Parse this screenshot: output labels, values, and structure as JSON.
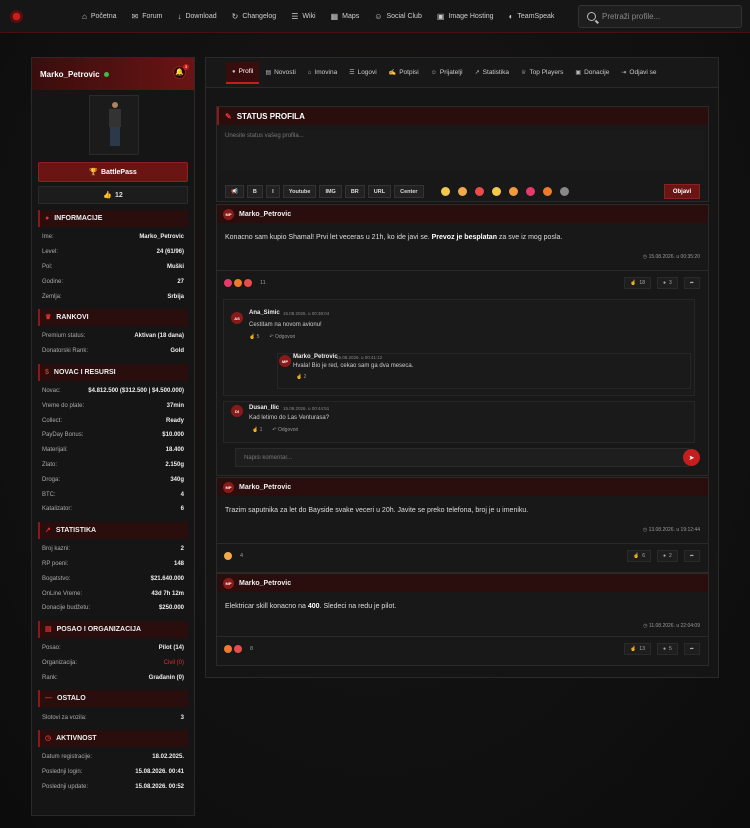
{
  "nav": {
    "items": [
      {
        "label": "Početna",
        "icon": "home-icon"
      },
      {
        "label": "Forum",
        "icon": "comments-icon"
      },
      {
        "label": "Download",
        "icon": "download-icon"
      },
      {
        "label": "Changelog",
        "icon": "changelog-icon"
      },
      {
        "label": "Wiki",
        "icon": "book-icon"
      },
      {
        "label": "Maps",
        "icon": "map-icon"
      },
      {
        "label": "Social Club",
        "icon": "users-icon"
      },
      {
        "label": "Image Hosting",
        "icon": "image-icon"
      },
      {
        "label": "TeamSpeak",
        "icon": "headset-icon"
      }
    ],
    "search_placeholder": "Pretraži profile..."
  },
  "profile": {
    "name": "Marko_Petrovic",
    "notifications": "3",
    "battlepass_label": "BattlePass",
    "likes": "12"
  },
  "sections": [
    {
      "title": "INFORMACIJE",
      "icon": "user-icon",
      "rows": [
        {
          "k": "Ime:",
          "v": "Marko_Petrovic"
        },
        {
          "k": "Level:",
          "v": "24 (61/96)"
        },
        {
          "k": "Pol:",
          "v": "Muški"
        },
        {
          "k": "Godine:",
          "v": "27"
        },
        {
          "k": "Zemlja:",
          "v": "Srbija"
        }
      ]
    },
    {
      "title": "RANKOVI",
      "icon": "crown-icon",
      "rows": [
        {
          "k": "Premium status:",
          "v": "Aktivan (18 dana)"
        },
        {
          "k": "Donatorski Rank:",
          "v": "Gold"
        }
      ]
    },
    {
      "title": "NOVAC I RESURSI",
      "icon": "dollar-icon",
      "rows": [
        {
          "k": "Novac:",
          "v": "$4.812.500 ($312.500 | $4.500.000)"
        },
        {
          "k": "Vreme do plate:",
          "v": "37min"
        },
        {
          "k": "Collect:",
          "v": "Ready"
        },
        {
          "k": "PayDay Bonus:",
          "v": "$10.000"
        },
        {
          "k": "Materijali:",
          "v": "18.400"
        },
        {
          "k": "Zlato:",
          "v": "2.150g"
        },
        {
          "k": "Droga:",
          "v": "340g"
        },
        {
          "k": "BTC:",
          "v": "4"
        },
        {
          "k": "Katalizator:",
          "v": "6"
        }
      ]
    },
    {
      "title": "STATISTIKA",
      "icon": "chart-icon",
      "rows": [
        {
          "k": "Broj kazni:",
          "v": "2"
        },
        {
          "k": "RP poeni:",
          "v": "148"
        },
        {
          "k": "Bogatstvo:",
          "v": "$21.640.000"
        },
        {
          "k": "OnLine Vreme:",
          "v": "43d 7h 12m"
        },
        {
          "k": "Donacije budžetu:",
          "v": "$250.000"
        }
      ]
    },
    {
      "title": "POSAO I ORGANIZACIJA",
      "icon": "briefcase-icon",
      "rows": [
        {
          "k": "Posao:",
          "v": "Pilot (14)"
        },
        {
          "k": "Organizacija:",
          "v": "Civil (0)",
          "red": true
        },
        {
          "k": "Rank:",
          "v": "Građanin (0)"
        }
      ]
    },
    {
      "title": "OSTALO",
      "icon": "dash-icon",
      "rows": [
        {
          "k": "Slotovi za vozila:",
          "v": "3"
        }
      ]
    },
    {
      "title": "AKTIVNOST",
      "icon": "clock-icon",
      "rows": [
        {
          "k": "Datum registracije:",
          "v": "18.02.2025."
        },
        {
          "k": "Poslednji login:",
          "v": "15.08.2026. 00:41"
        },
        {
          "k": "Poslednji update:",
          "v": "15.08.2026. 00:52"
        }
      ]
    }
  ],
  "tabs": [
    {
      "label": "Profil",
      "icon": "user-icon",
      "active": true
    },
    {
      "label": "Novosti",
      "icon": "news-icon"
    },
    {
      "label": "Imovina",
      "icon": "home-icon"
    },
    {
      "label": "Logovi",
      "icon": "list-icon"
    },
    {
      "label": "Potpisi",
      "icon": "signature-icon"
    },
    {
      "label": "Prijatelji",
      "icon": "friends-icon"
    },
    {
      "label": "Statistika",
      "icon": "chart-icon"
    },
    {
      "label": "Top Players",
      "icon": "trophy-icon"
    },
    {
      "label": "Donacije",
      "icon": "donate-icon"
    },
    {
      "label": "Odjavi se",
      "icon": "logout-icon"
    }
  ],
  "status": {
    "title": "STATUS PROFILA",
    "placeholder": "Unesite status vašeg profila...",
    "toolbar": [
      "B",
      "I",
      "Youtube",
      "IMG",
      "BR",
      "URL",
      "Center"
    ],
    "submit": "Objavi"
  },
  "posts": [
    {
      "avatar": "MP",
      "author": "Marko_Petrovic",
      "text_before": "Konacno sam kupio Shamal! Prvi let veceras u 21h, ko ide javi se. ",
      "text_bold": "Prevoz je besplatan",
      "text_after": " za sve iz mog posla.",
      "date": "15.08.2026. u 00:35:20",
      "reaction_count": "11",
      "likes": "18",
      "comments": "3"
    },
    {
      "avatar": "MP",
      "author": "Marko_Petrovic",
      "text_before": "Trazim saputnika za let do Bayside svake veceri u 20h. Javite se preko telefona, broj je u imeniku.",
      "text_bold": "",
      "text_after": "",
      "date": "13.08.2026. u 19:12:44",
      "reaction_count": "4",
      "likes": "6",
      "comments": "2"
    },
    {
      "avatar": "MP",
      "author": "Marko_Petrovic",
      "text_before": "Elektricar skill konacno na ",
      "text_bold": "400",
      "text_after": ". Sledeci na redu je pilot.",
      "date": "11.08.2026. u 22:04:09",
      "reaction_count": "8",
      "likes": "13",
      "comments": "5"
    }
  ],
  "comments": [
    {
      "avatar": "AS",
      "author": "Ana_Simic",
      "date": "15.08.2026. u 00:38:04",
      "text": "Cestitam na novom avionu!",
      "likes": "5",
      "reply": "Odgovori"
    },
    {
      "avatar": "MP",
      "author": "Marko_Petrovic",
      "date": "15.08.2026. u 00:41:12",
      "text": "Hvala! Bio je red, cekao sam ga dva meseca.",
      "likes": "2"
    },
    {
      "avatar": "DI",
      "author": "Dusan_Ilic",
      "date": "15.08.2026. u 00:44:51",
      "text": "Kad letimo do Las Venturasa?",
      "likes": "1",
      "reply": "Odgovori"
    }
  ],
  "new_comment_placeholder": "Napiši komentar...",
  "colors": {
    "accent": "#c41e1e",
    "header_bg": "#2a0d0d",
    "online": "#3dbb47"
  }
}
